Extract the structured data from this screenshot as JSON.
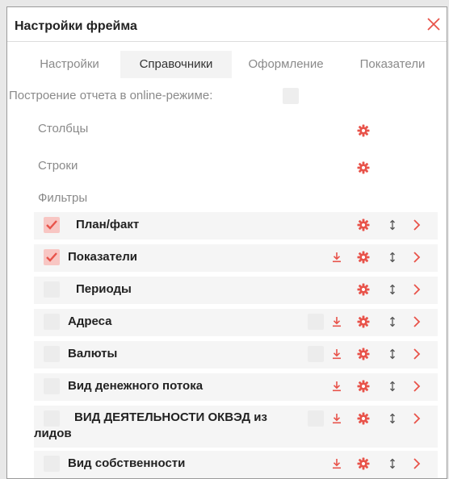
{
  "dialog": {
    "title": "Настройки фрейма"
  },
  "tabs": [
    {
      "label": "Настройки",
      "active": false
    },
    {
      "label": "Справочники",
      "active": true
    },
    {
      "label": "Оформление",
      "active": false
    },
    {
      "label": "Показатели",
      "active": false
    }
  ],
  "online": {
    "label": "Построение отчета в online-режиме:",
    "checked": false
  },
  "sections": {
    "columns": "Столбцы",
    "rows": "Строки",
    "filters": "Фильтры"
  },
  "filters": [
    {
      "label": "План/факт",
      "checked": true,
      "download": false,
      "extra_checkbox": false
    },
    {
      "label": "Показатели",
      "checked": true,
      "download": true,
      "extra_checkbox": false
    },
    {
      "label": "Периоды",
      "checked": false,
      "download": false,
      "extra_checkbox": false
    },
    {
      "label": "Адреса",
      "checked": false,
      "download": true,
      "extra_checkbox": true
    },
    {
      "label": "Валюты",
      "checked": false,
      "download": true,
      "extra_checkbox": true
    },
    {
      "label": "Вид денежного потока",
      "checked": false,
      "download": true,
      "extra_checkbox": false
    },
    {
      "label": "ВИД ДЕЯТЕЛЬНОСТИ ОКВЭД из лидов",
      "checked": false,
      "download": true,
      "extra_checkbox": true
    },
    {
      "label": "Вид собственности",
      "checked": false,
      "download": true,
      "extra_checkbox": false
    }
  ],
  "colors": {
    "accent": "#e8534a",
    "checkbox_bg": "#ececec",
    "checked_bg": "#f8c6c3"
  },
  "icons": {
    "close": "close-icon",
    "gear": "gear-icon",
    "download": "download-icon",
    "sort": "sort-arrows-icon",
    "chevron": "chevron-right-icon",
    "check": "check-icon"
  }
}
